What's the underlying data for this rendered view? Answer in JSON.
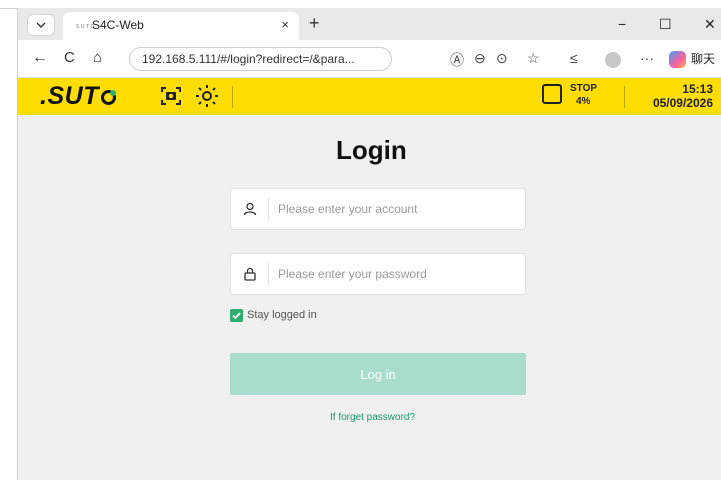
{
  "browser": {
    "tab": {
      "title": "S4C-Web",
      "favicon": "suto-favicon",
      "close_glyph": "×"
    },
    "new_tab_glyph": "+",
    "window_controls": {
      "minimize": "−",
      "maximize": "☐",
      "close": "✕"
    },
    "nav": {
      "back": "←",
      "reload": "C",
      "home": "⌂"
    },
    "url": "192.168.5.111/#/login?redirect=/&para...",
    "toolbar": {
      "more": "···",
      "translate_label": "聊天"
    }
  },
  "app_header": {
    "logo": ".SUT",
    "stop": {
      "title": "STOP",
      "percent": "4%"
    },
    "time": "15:13",
    "date": "05/09/2026",
    "colors": {
      "background": "#ffdd00"
    }
  },
  "login": {
    "title": "Login",
    "account": {
      "placeholder": "Please enter your account",
      "value": ""
    },
    "password": {
      "placeholder": "Please enter your password",
      "value": ""
    },
    "remember_label": "Stay logged in",
    "remember_checked": true,
    "button_label": "Log in",
    "forgot_label": "If forget password?",
    "colors": {
      "accent": "#2fae72",
      "button_disabled": "#a8ddcd"
    }
  }
}
